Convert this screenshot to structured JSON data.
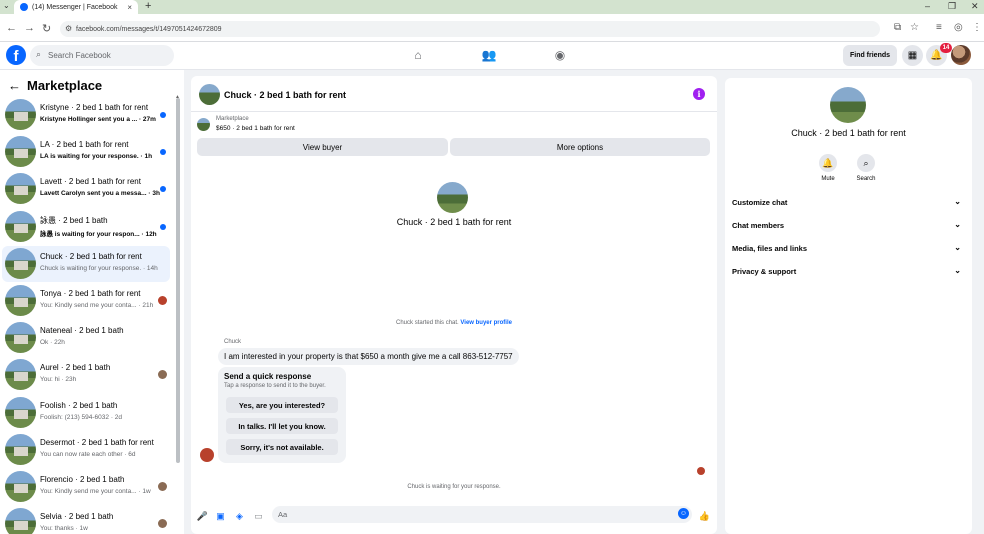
{
  "browser": {
    "tab_title": "(14) Messenger | Facebook",
    "tab_close": "×",
    "new_tab": "+",
    "tab_menu": "⌄",
    "url": "facebook.com/messages/t/1497051424672809",
    "win_min": "–",
    "win_max": "❐",
    "win_close": "✕"
  },
  "header": {
    "search_placeholder": "Search Facebook",
    "find_friends": "Find friends",
    "notif_count": "14"
  },
  "sidebar": {
    "title": "Marketplace",
    "conversations": [
      {
        "name": "Kristyne · 2 bed 1 bath for rent",
        "preview": "Kristyne Hollinger sent you a ... · 27m",
        "unread": true
      },
      {
        "name": "LA · 2 bed 1 bath for rent",
        "preview": "LA is waiting for your response. · 1h",
        "unread": true
      },
      {
        "name": "Lavett · 2 bed 1 bath for rent",
        "preview": "Lavett Carolyn sent you a messa... · 3h",
        "unread": true
      },
      {
        "name": "詠愚 · 2 bed 1 bath",
        "preview": "詠愚 is waiting for your respon... · 12h",
        "unread": true
      },
      {
        "name": "Chuck · 2 bed 1 bath for rent",
        "preview": "Chuck is waiting for your response. · 14h",
        "unread": false
      },
      {
        "name": "Tonya · 2 bed 1 bath for rent",
        "preview": "You: Kindly send me your conta... · 21h",
        "unread": false
      },
      {
        "name": "Nateneal · 2 bed 1 bath",
        "preview": "Ok · 22h",
        "unread": false
      },
      {
        "name": "Aurel · 2 bed 1 bath",
        "preview": "You: hi · 23h",
        "unread": false
      },
      {
        "name": "Foolish · 2 bed 1 bath",
        "preview": "Foolish: (213) 594-6032 · 2d",
        "unread": false
      },
      {
        "name": "Desermot · 2 bed 1 bath for rent",
        "preview": "You can now rate each other · 6d",
        "unread": false
      },
      {
        "name": "Florencio · 2 bed 1 bath",
        "preview": "You: Kindly send me your conta... · 1w",
        "unread": false
      },
      {
        "name": "Selvia · 2 bed 1 bath",
        "preview": "You: thanks · 1w",
        "unread": false
      }
    ]
  },
  "chat": {
    "title": "Chuck · 2 bed 1 bath for rent",
    "listing_label": "Marketplace",
    "listing_detail": "$650 · 2 bed 1 bath for rent",
    "view_buyer": "View buyer",
    "more_options": "More options",
    "intro_title": "Chuck · 2 bed 1 bath for rent",
    "started_text": "Chuck started this chat.",
    "view_profile": "View buyer profile",
    "sender": "Chuck",
    "message": "I am interested in your property is that $650 a month give me a call 863​-512-7757",
    "quick_title": "Send a quick response",
    "quick_sub": "Tap a response to send it to the buyer.",
    "quick_1": "Yes, are you interested?",
    "quick_2": "In talks. I'll let you know.",
    "quick_3": "Sorry, it's not available.",
    "waiting": "Chuck is waiting for your response.",
    "input_placeholder": "Aa"
  },
  "details": {
    "title": "Chuck · 2 bed 1 bath for rent",
    "mute": "Mute",
    "search": "Search",
    "rows": [
      "Customize chat",
      "Chat members",
      "Media, files and links",
      "Privacy & support"
    ]
  },
  "colors": {
    "accent": "#0866ff",
    "unread_dot": "#0866ff",
    "badge": "#e41e3f",
    "info": "#a020f0"
  }
}
